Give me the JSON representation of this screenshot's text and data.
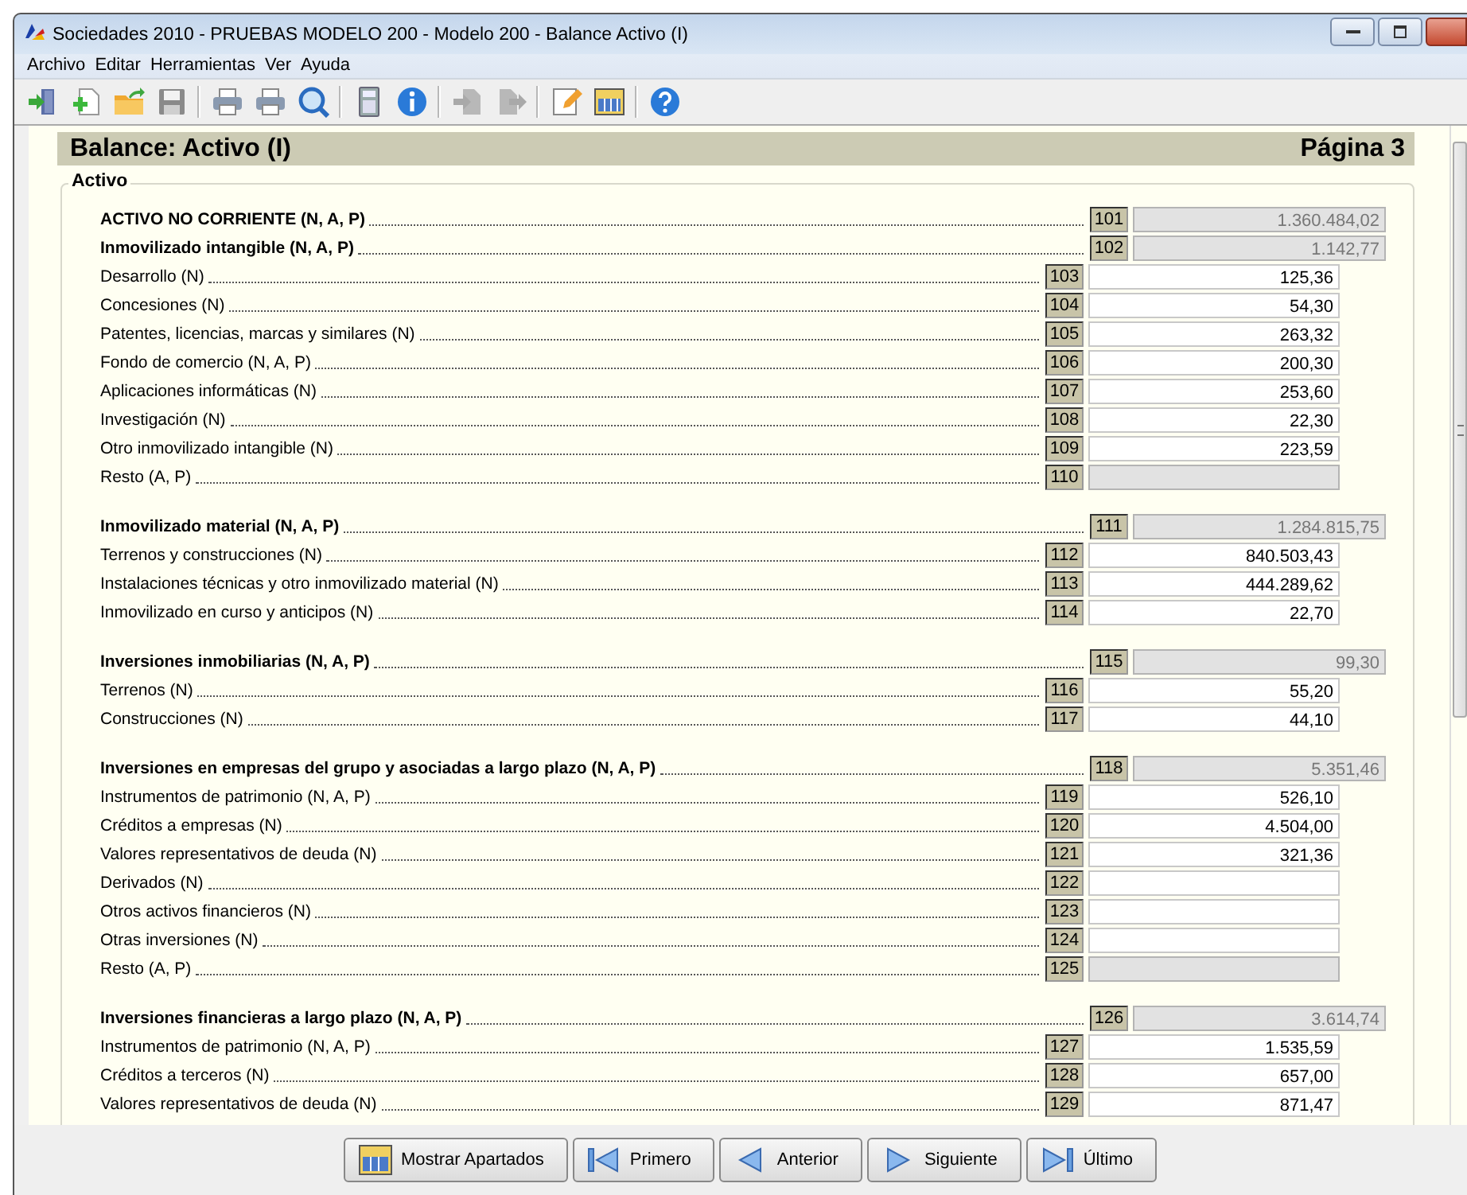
{
  "window": {
    "title": "Sociedades 2010 - PRUEBAS MODELO 200 - Modelo 200 - Balance Activo (I)"
  },
  "menu": [
    "Archivo",
    "Editar",
    "Herramientas",
    "Ver",
    "Ayuda"
  ],
  "toolbar": [
    {
      "kind": "exit",
      "disabled": false
    },
    {
      "kind": "new",
      "disabled": false
    },
    {
      "kind": "open",
      "disabled": false
    },
    {
      "kind": "save",
      "disabled": false
    },
    {
      "kind": "separator"
    },
    {
      "kind": "print",
      "disabled": false
    },
    {
      "kind": "print",
      "disabled": false
    },
    {
      "kind": "preview",
      "disabled": false
    },
    {
      "kind": "separator"
    },
    {
      "kind": "calculator",
      "disabled": false
    },
    {
      "kind": "info",
      "disabled": false
    },
    {
      "kind": "separator"
    },
    {
      "kind": "import",
      "disabled": true
    },
    {
      "kind": "export",
      "disabled": true
    },
    {
      "kind": "separator"
    },
    {
      "kind": "edit",
      "disabled": false
    },
    {
      "kind": "sections",
      "disabled": false
    },
    {
      "kind": "separator"
    },
    {
      "kind": "help",
      "disabled": false
    }
  ],
  "page": {
    "title": "Balance: Activo (I)",
    "page_label": "Página 3",
    "section": "Activo"
  },
  "groups": [
    {
      "rows": [
        {
          "kind": "total",
          "label": "ACTIVO NO CORRIENTE (N, A, P)",
          "code": "101",
          "value": "1.360.484,02",
          "editable": false
        },
        {
          "kind": "total",
          "label": "Inmovilizado intangible (N, A, P)",
          "code": "102",
          "value": "1.142,77",
          "editable": false
        },
        {
          "kind": "detail",
          "label": "Desarrollo (N)",
          "code": "103",
          "value": "125,36",
          "editable": true
        },
        {
          "kind": "detail",
          "label": "Concesiones (N)",
          "code": "104",
          "value": "54,30",
          "editable": true
        },
        {
          "kind": "detail",
          "label": "Patentes, licencias, marcas y similares (N)",
          "code": "105",
          "value": "263,32",
          "editable": true
        },
        {
          "kind": "detail",
          "label": "Fondo de comercio (N, A, P)",
          "code": "106",
          "value": "200,30",
          "editable": true
        },
        {
          "kind": "detail",
          "label": "Aplicaciones informáticas (N)",
          "code": "107",
          "value": "253,60",
          "editable": true
        },
        {
          "kind": "detail",
          "label": "Investigación (N)",
          "code": "108",
          "value": "22,30",
          "editable": true
        },
        {
          "kind": "detail",
          "label": "Otro inmovilizado intangible (N)",
          "code": "109",
          "value": "223,59",
          "editable": true
        },
        {
          "kind": "detail",
          "label": "Resto (A, P)",
          "code": "110",
          "editable": false
        }
      ]
    },
    {
      "rows": [
        {
          "kind": "total",
          "label": "Inmovilizado material (N, A, P)",
          "code": "111",
          "value": "1.284.815,75",
          "editable": false
        },
        {
          "kind": "detail",
          "label": "Terrenos y construcciones (N)",
          "code": "112",
          "value": "840.503,43",
          "editable": true
        },
        {
          "kind": "detail",
          "label": "Instalaciones técnicas y otro inmovilizado material (N)",
          "code": "113",
          "value": "444.289,62",
          "editable": true
        },
        {
          "kind": "detail",
          "label": "Inmovilizado en curso y anticipos (N)",
          "code": "114",
          "value": "22,70",
          "editable": true
        }
      ]
    },
    {
      "rows": [
        {
          "kind": "total",
          "label": "Inversiones inmobiliarias (N, A, P)",
          "code": "115",
          "value": "99,30",
          "editable": false
        },
        {
          "kind": "detail",
          "label": "Terrenos (N)",
          "code": "116",
          "value": "55,20",
          "editable": true
        },
        {
          "kind": "detail",
          "label": "Construcciones (N)",
          "code": "117",
          "value": "44,10",
          "editable": true
        }
      ]
    },
    {
      "rows": [
        {
          "kind": "total",
          "label": "Inversiones en empresas del grupo y asociadas a largo plazo (N, A, P)",
          "code": "118",
          "value": "5.351,46",
          "editable": false
        },
        {
          "kind": "detail",
          "label": "Instrumentos de patrimonio (N, A, P)",
          "code": "119",
          "value": "526,10",
          "editable": true
        },
        {
          "kind": "detail",
          "label": "Créditos a empresas (N)",
          "code": "120",
          "value": "4.504,00",
          "editable": true
        },
        {
          "kind": "detail",
          "label": "Valores representativos de deuda (N)",
          "code": "121",
          "value": "321,36",
          "editable": true
        },
        {
          "kind": "detail",
          "label": "Derivados (N)",
          "code": "122",
          "editable": true
        },
        {
          "kind": "detail",
          "label": "Otros activos financieros (N)",
          "code": "123",
          "editable": true
        },
        {
          "kind": "detail",
          "label": "Otras inversiones (N)",
          "code": "124",
          "editable": true
        },
        {
          "kind": "detail",
          "label": "Resto (A, P)",
          "code": "125",
          "editable": false
        }
      ]
    },
    {
      "rows": [
        {
          "kind": "total",
          "label": "Inversiones financieras a largo plazo (N, A, P)",
          "code": "126",
          "value": "3.614,74",
          "editable": false
        },
        {
          "kind": "detail",
          "label": "Instrumentos de patrimonio (N, A, P)",
          "code": "127",
          "value": "1.535,59",
          "editable": true
        },
        {
          "kind": "detail",
          "label": "Créditos a terceros (N)",
          "code": "128",
          "value": "657,00",
          "editable": true
        },
        {
          "kind": "detail",
          "label": "Valores representativos de deuda (N)",
          "code": "129",
          "value": "871,47",
          "editable": true
        }
      ]
    }
  ],
  "buttons": [
    {
      "kind": "sections",
      "label": "Mostrar Apartados"
    },
    {
      "kind": "first",
      "label": "Primero"
    },
    {
      "kind": "previous",
      "label": "Anterior"
    },
    {
      "kind": "next",
      "label": "Siguiente"
    },
    {
      "kind": "last",
      "label": "Último"
    }
  ]
}
